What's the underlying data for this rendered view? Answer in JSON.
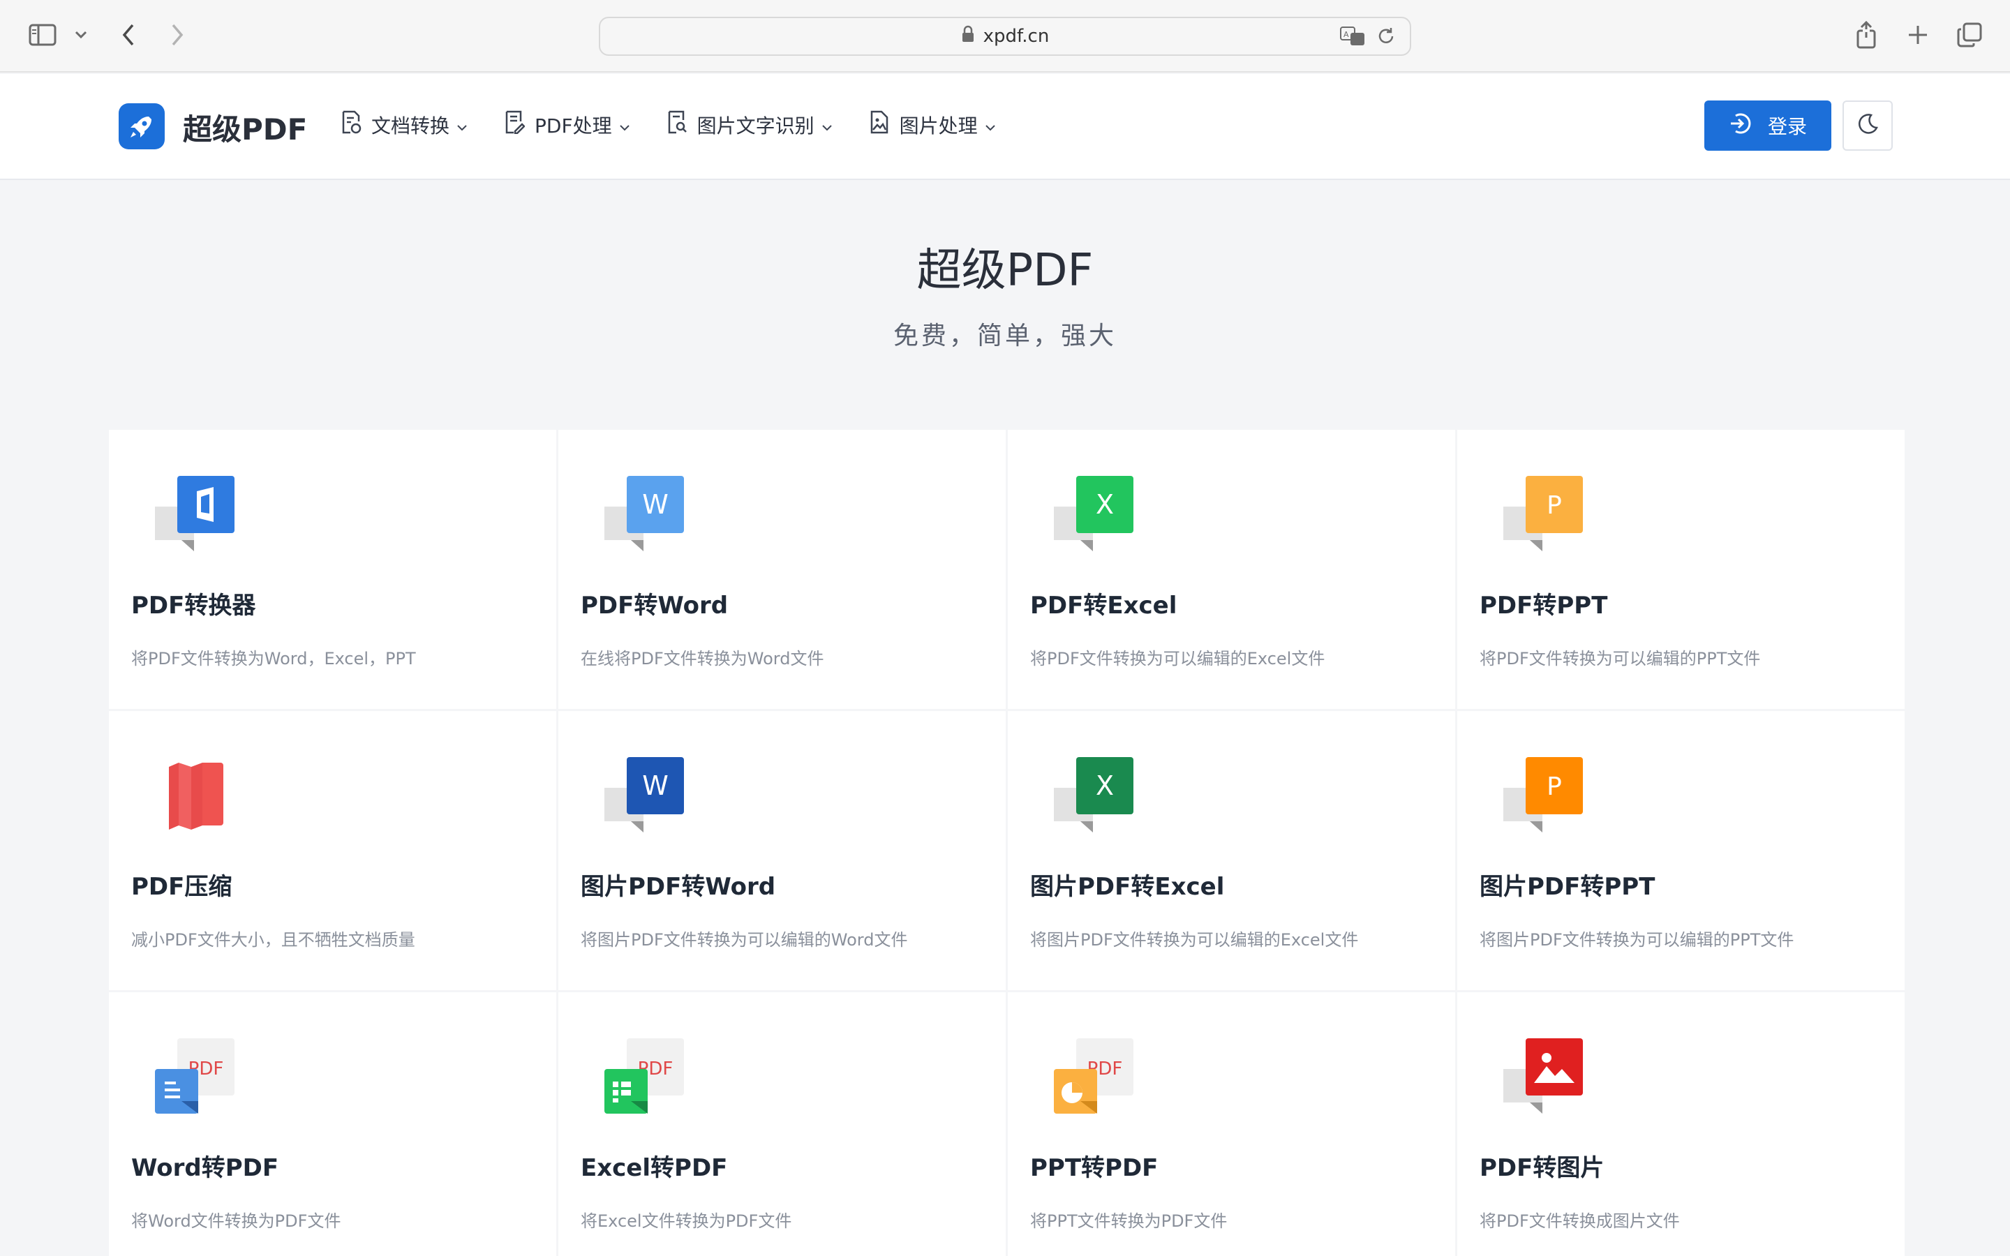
{
  "browser": {
    "url": "xpdf.cn"
  },
  "header": {
    "logo_text": "超级PDF",
    "nav": [
      {
        "label": "文档转换"
      },
      {
        "label": "PDF处理"
      },
      {
        "label": "图片文字识别"
      },
      {
        "label": "图片处理"
      }
    ],
    "login_label": "登录"
  },
  "hero": {
    "title": "超级PDF",
    "subtitle": "免费，简单，强大"
  },
  "colors": {
    "primary": "#1c6fd9",
    "word_light": "#5aa2ee",
    "excel_light": "#22c55e",
    "ppt_light": "#fbb040",
    "compress": "#ef5350",
    "word_dark": "#1e56b3",
    "excel_dark": "#1a8a4f",
    "ppt_dark": "#ff8a00",
    "image_red": "#e02020"
  },
  "cards": [
    {
      "title": "PDF转换器",
      "desc": "将PDF文件转换为Word，Excel，PPT",
      "icon": "office-icon"
    },
    {
      "title": "PDF转Word",
      "desc": "在线将PDF文件转换为Word文件",
      "icon": "word-icon",
      "letter": "W"
    },
    {
      "title": "PDF转Excel",
      "desc": "将PDF文件转换为可以编辑的Excel文件",
      "icon": "excel-icon",
      "letter": "X"
    },
    {
      "title": "PDF转PPT",
      "desc": "将PDF文件转换为可以编辑的PPT文件",
      "icon": "ppt-icon",
      "letter": "P"
    },
    {
      "title": "PDF压缩",
      "desc": "减小PDF文件大小，且不牺牲文档质量",
      "icon": "compress-map-icon"
    },
    {
      "title": "图片PDF转Word",
      "desc": "将图片PDF文件转换为可以编辑的Word文件",
      "icon": "word-dark-icon",
      "letter": "W"
    },
    {
      "title": "图片PDF转Excel",
      "desc": "将图片PDF文件转换为可以编辑的Excel文件",
      "icon": "excel-dark-icon",
      "letter": "X"
    },
    {
      "title": "图片PDF转PPT",
      "desc": "将图片PDF文件转换为可以编辑的PPT文件",
      "icon": "ppt-dark-icon",
      "letter": "P"
    },
    {
      "title": "Word转PDF",
      "desc": "将Word文件转换为PDF文件",
      "icon": "word-to-pdf-icon",
      "badge": "PDF"
    },
    {
      "title": "Excel转PDF",
      "desc": "将Excel文件转换为PDF文件",
      "icon": "excel-to-pdf-icon",
      "badge": "PDF"
    },
    {
      "title": "PPT转PDF",
      "desc": "将PPT文件转换为PDF文件",
      "icon": "ppt-to-pdf-icon",
      "badge": "PDF"
    },
    {
      "title": "PDF转图片",
      "desc": "将PDF文件转换成图片文件",
      "icon": "image-icon"
    }
  ]
}
